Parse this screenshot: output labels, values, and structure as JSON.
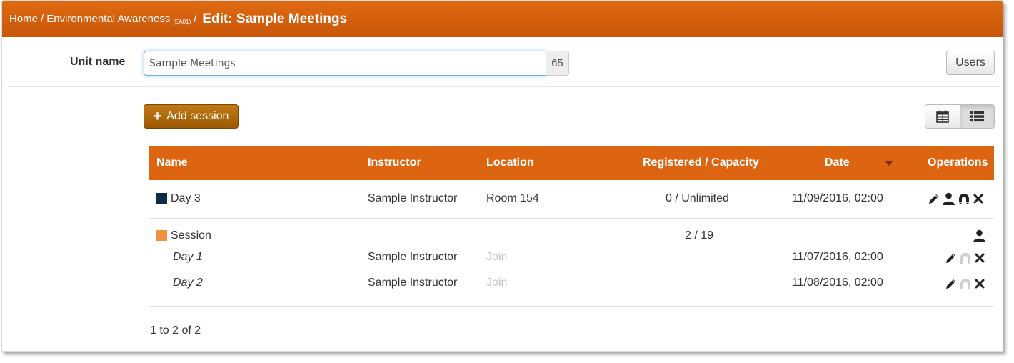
{
  "breadcrumb": {
    "home": "Home",
    "sep1": "/",
    "course": "Environmental Awareness",
    "course_code": "(EA01)",
    "sep2": "/",
    "edit_title": "Edit: Sample Meetings"
  },
  "form": {
    "unit_label": "Unit name",
    "unit_value": "Sample Meetings",
    "char_count": "65",
    "users_button": "Users"
  },
  "toolbar": {
    "add_session": "Add session",
    "views": [
      "calendar-view",
      "list-view"
    ],
    "active_view": "list-view"
  },
  "table": {
    "columns": [
      "Name",
      "Instructor",
      "Location",
      "Registered / Capacity",
      "Date",
      "Operations"
    ],
    "sorted_by": "Date",
    "rows": [
      {
        "name": "Day 3",
        "color": "#0d2b45",
        "instructor": "Sample Instructor",
        "location": "Room 154",
        "registered": "0 / Unlimited",
        "date": "11/09/2016, 02:00",
        "operations": [
          "edit-icon",
          "user-icon",
          "magnet-icon",
          "delete-icon"
        ]
      },
      {
        "name": "Session",
        "color": "#ef9140",
        "registered": "2 / 19",
        "operations": [
          "user-icon"
        ],
        "children": [
          {
            "name": "Day 1",
            "instructor": "Sample Instructor",
            "location": "Join",
            "date": "11/07/2016, 02:00",
            "operations": [
              "edit-icon",
              "magnet-icon-disabled",
              "delete-icon"
            ]
          },
          {
            "name": "Day 2",
            "instructor": "Sample Instructor",
            "location": "Join",
            "date": "11/08/2016, 02:00",
            "operations": [
              "edit-icon",
              "magnet-icon-disabled",
              "delete-icon"
            ]
          }
        ]
      }
    ]
  },
  "pagination": {
    "summary": "1 to 2 of 2"
  },
  "colors": {
    "header": "#dd6411",
    "add_button": "#b06d0e",
    "focus": "#66afe9"
  }
}
